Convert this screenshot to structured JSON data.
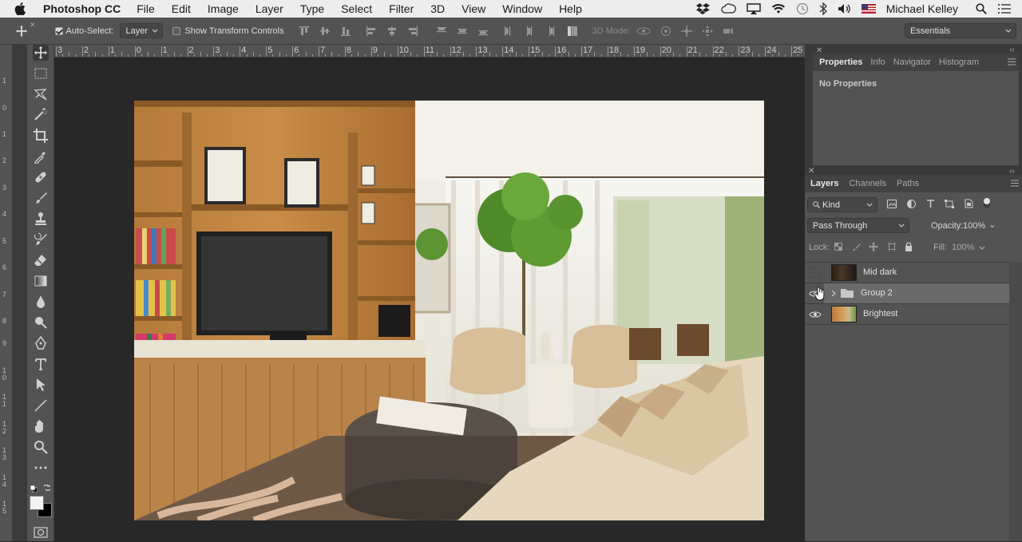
{
  "menubar": {
    "app_name": "Photoshop CC",
    "items": [
      "File",
      "Edit",
      "Image",
      "Layer",
      "Type",
      "Select",
      "Filter",
      "3D",
      "View",
      "Window",
      "Help"
    ],
    "user": "Michael Kelley"
  },
  "options": {
    "auto_select_label": "Auto-Select:",
    "auto_select_checked": true,
    "auto_select_value": "Layer",
    "show_transform_label": "Show Transform Controls",
    "show_transform_checked": false,
    "mode_3d_label": "3D Mode:",
    "workspace": "Essentials"
  },
  "ruler": {
    "top_labels": [
      "3",
      "2",
      "1",
      "0",
      "1",
      "2",
      "3",
      "4",
      "5",
      "6",
      "7",
      "8",
      "9",
      "10",
      "11",
      "12",
      "13",
      "14",
      "15",
      "16",
      "17",
      "18",
      "19",
      "20",
      "21",
      "22",
      "23",
      "24",
      "25"
    ],
    "left_labels": [
      "1",
      "0",
      "1",
      "2",
      "3",
      "4",
      "5",
      "6",
      "7",
      "8",
      "9",
      "1 0",
      "1 1",
      "1 2",
      "1 3",
      "1 4",
      "1 5"
    ]
  },
  "tools": [
    {
      "name": "move-tool-icon"
    },
    {
      "name": "marquee-tool-icon"
    },
    {
      "name": "lasso-tool-icon"
    },
    {
      "name": "magic-wand-tool-icon"
    },
    {
      "name": "crop-tool-icon"
    },
    {
      "name": "eyedropper-tool-icon"
    },
    {
      "name": "healing-brush-tool-icon"
    },
    {
      "name": "brush-tool-icon"
    },
    {
      "name": "stamp-tool-icon"
    },
    {
      "name": "history-brush-tool-icon"
    },
    {
      "name": "eraser-tool-icon"
    },
    {
      "name": "gradient-tool-icon"
    },
    {
      "name": "blur-tool-icon"
    },
    {
      "name": "dodge-tool-icon"
    },
    {
      "name": "pen-tool-icon"
    },
    {
      "name": "type-tool-icon"
    },
    {
      "name": "path-selection-tool-icon"
    },
    {
      "name": "line-tool-icon"
    },
    {
      "name": "hand-tool-icon"
    },
    {
      "name": "zoom-tool-icon"
    },
    {
      "name": "more-tools-icon"
    }
  ],
  "properties_panel": {
    "tabs": [
      "Properties",
      "Info",
      "Navigator",
      "Histogram"
    ],
    "active_tab": "Properties",
    "message": "No Properties"
  },
  "layers_panel": {
    "tabs": [
      "Layers",
      "Channels",
      "Paths"
    ],
    "active_tab": "Layers",
    "filter_kind": "Kind",
    "blend_mode": "Pass Through",
    "opacity_label": "Opacity:",
    "opacity": "100%",
    "lock_label": "Lock:",
    "fill_label": "Fill:",
    "fill": "100%",
    "layers": [
      {
        "name": "Mid dark",
        "type": "image",
        "visible": false,
        "selected": false
      },
      {
        "name": "Group 2",
        "type": "group",
        "visible": true,
        "selected": true
      },
      {
        "name": "Brightest",
        "type": "image",
        "visible": true,
        "selected": false
      }
    ]
  },
  "colors": {
    "accent_bg": "#535353",
    "canvas_bg": "#282828",
    "selected_layer": "#6a6a6a"
  }
}
